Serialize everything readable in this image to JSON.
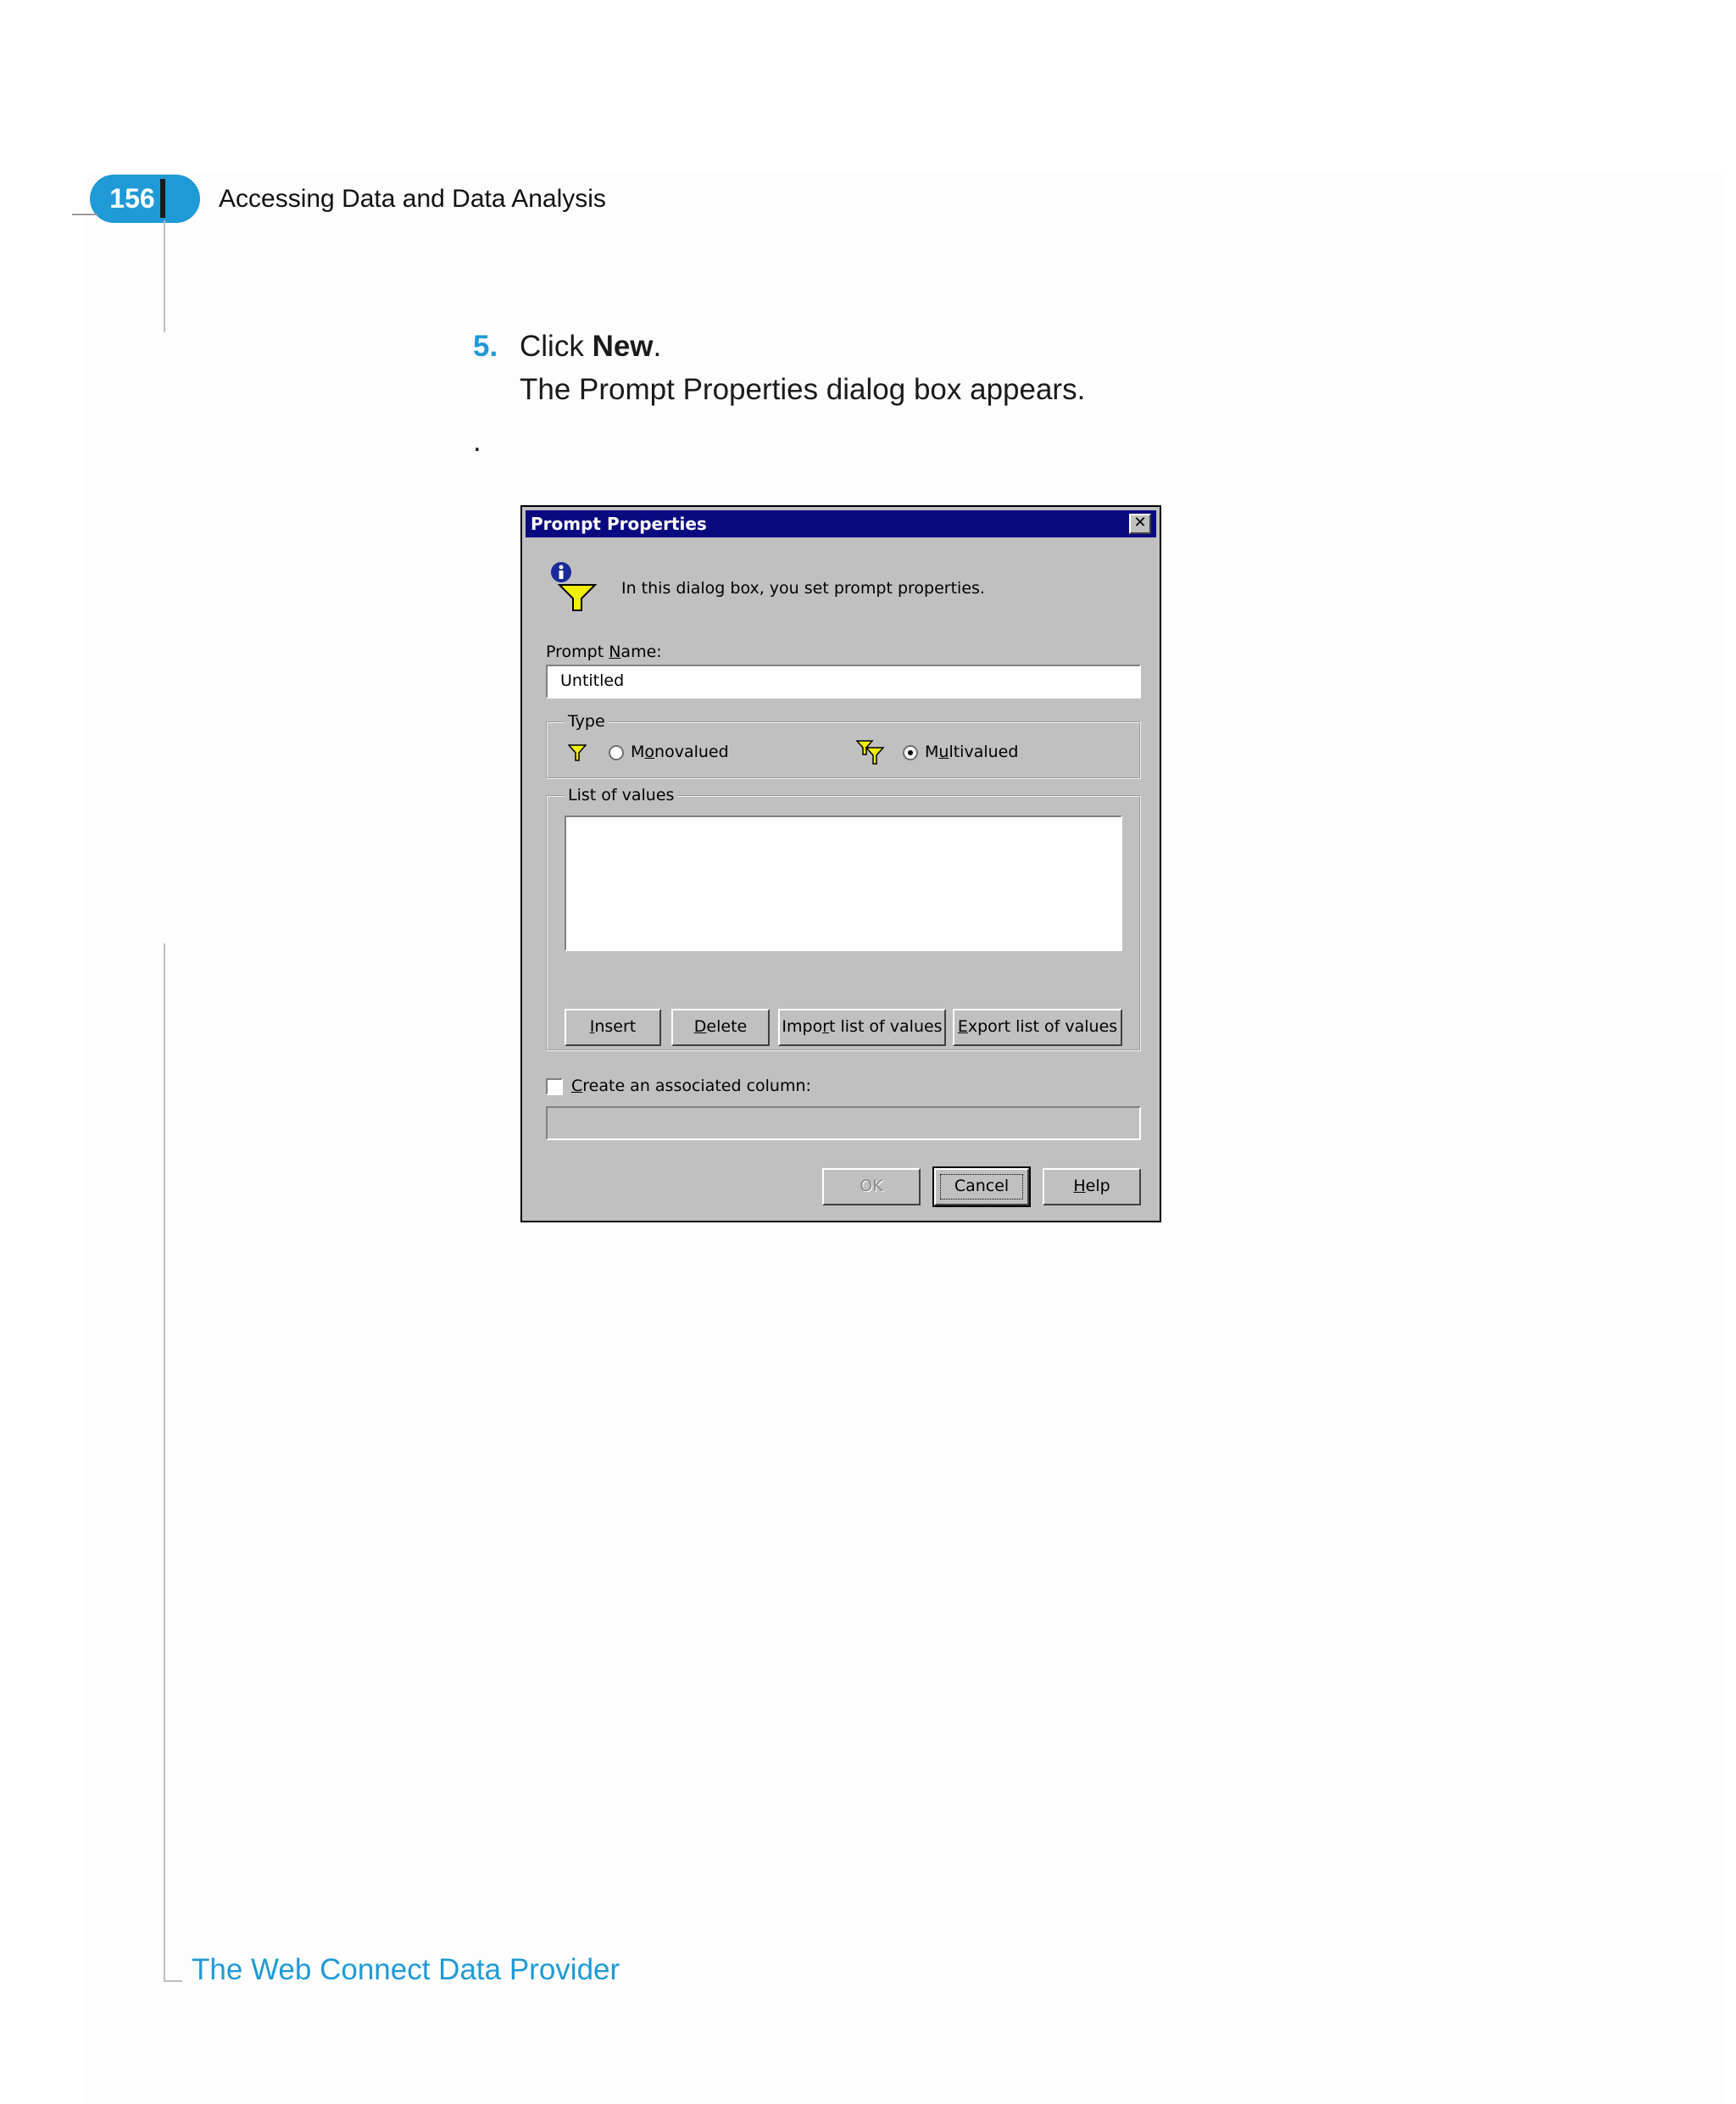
{
  "header": {
    "page_number": "156",
    "running_head": "Accessing Data and Data Analysis"
  },
  "step": {
    "number": "5.",
    "lead": "Click ",
    "command": "New",
    "trail": ".",
    "description": "The Prompt Properties dialog box appears.",
    "stray_mark": "."
  },
  "dialog": {
    "title": "Prompt Properties",
    "close_glyph": "✕",
    "intro": "In this dialog box, you set prompt properties.",
    "prompt_name_label_pre": "Prompt ",
    "prompt_name_label_key": "N",
    "prompt_name_label_post": "ame:",
    "prompt_name_value": "Untitled",
    "type_legend": "Type",
    "mono_pre": "M",
    "mono_key": "o",
    "mono_post": "novalued",
    "multi_pre": "M",
    "multi_key": "u",
    "multi_post": "ltivalued",
    "selected_type": "Multivalued",
    "list_legend": "List of values",
    "buttons": {
      "insert_key": "I",
      "insert_rest": "nsert",
      "delete_key": "D",
      "delete_rest": "elete",
      "import_pre": "Impo",
      "import_key": "r",
      "import_post": "t list of values",
      "export_key": "E",
      "export_rest": "xport list of values",
      "ok": "OK",
      "cancel": "Cancel",
      "help_key": "H",
      "help_rest": "elp"
    },
    "assoc_key": "C",
    "assoc_rest": "reate an associated column:",
    "assoc_checked": false
  },
  "footer": {
    "section_title": "The Web Connect Data Provider"
  },
  "colors": {
    "accent": "#1f9ad6",
    "titlebar": "#0a0a80",
    "dialog_face": "#c0c0c0"
  }
}
